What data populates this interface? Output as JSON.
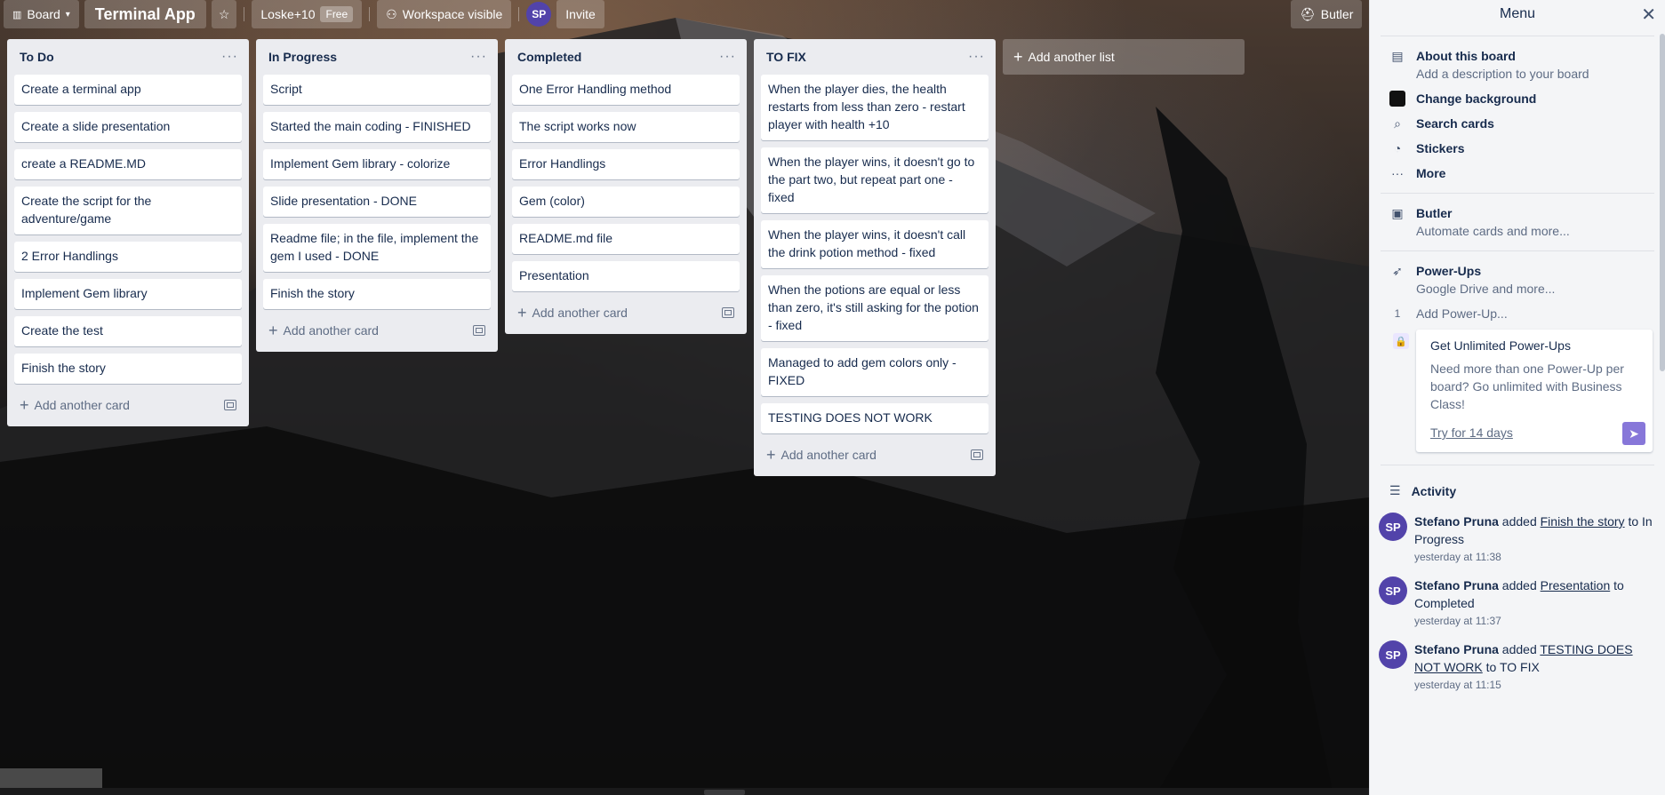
{
  "header": {
    "board_switch_label": "Board",
    "board_title": "Terminal App",
    "workspace_name": "Loske+10",
    "plan_badge": "Free",
    "visibility_label": "Workspace visible",
    "member_initials": "SP",
    "invite_label": "Invite",
    "butler_label": "Butler"
  },
  "lists": [
    {
      "title": "To Do",
      "cards": [
        "Create a terminal app",
        "Create a slide presentation",
        "create a README.MD",
        "Create the script for the adventure/game",
        "2 Error Handlings",
        "Implement Gem library",
        "Create the test",
        "Finish the story"
      ],
      "add_label": "Add another card"
    },
    {
      "title": "In Progress",
      "cards": [
        "Script",
        "Started the main coding - FINISHED",
        "Implement Gem library - colorize",
        "Slide presentation - DONE",
        "Readme file; in the file, implement the gem I used - DONE",
        "Finish the story"
      ],
      "add_label": "Add another card"
    },
    {
      "title": "Completed",
      "cards": [
        "One Error Handling method",
        "The script works now",
        "Error Handlings",
        "Gem (color)",
        "README.md file",
        "Presentation"
      ],
      "add_label": "Add another card"
    },
    {
      "title": "TO FIX",
      "cards": [
        "When the player dies, the health restarts from less than zero - restart player with health +10",
        "When the player wins, it doesn't go to the part two, but repeat part one - fixed",
        "When the player wins, it doesn't call the drink potion method - fixed",
        "When the potions are equal or less than zero, it's still asking for the potion - fixed",
        "Managed to add gem colors only - FIXED",
        "TESTING DOES NOT WORK"
      ],
      "add_label": "Add another card"
    }
  ],
  "add_list_label": "Add another list",
  "menu": {
    "title": "Menu",
    "about_title": "About this board",
    "about_sub": "Add a description to your board",
    "change_bg": "Change background",
    "search_cards": "Search cards",
    "stickers": "Stickers",
    "more": "More",
    "butler_title": "Butler",
    "butler_sub": "Automate cards and more...",
    "powerups_title": "Power-Ups",
    "powerups_sub": "Google Drive and more...",
    "powerup_count": "1",
    "add_powerup": "Add Power-Up...",
    "upsell_title": "Get Unlimited Power-Ups",
    "upsell_body": "Need more than one Power-Up per board? Go unlimited with Business Class!",
    "upsell_link": "Try for 14 days",
    "activity_title": "Activity"
  },
  "activity": [
    {
      "initials": "SP",
      "user": "Stefano Pruna",
      "verb": "added",
      "card": "Finish the story",
      "rest": "to In Progress",
      "time": "yesterday at 11:38"
    },
    {
      "initials": "SP",
      "user": "Stefano Pruna",
      "verb": "added",
      "card": "Presentation",
      "rest": "to Completed",
      "time": "yesterday at 11:37"
    },
    {
      "initials": "SP",
      "user": "Stefano Pruna",
      "verb": "added",
      "card": "TESTING DOES NOT WORK",
      "rest": "to TO FIX",
      "time": "yesterday at 11:15"
    }
  ],
  "colors": {
    "avatar": "#5243aa",
    "list_bg": "#ebecf0",
    "upsell_accent": "#8777d9"
  }
}
